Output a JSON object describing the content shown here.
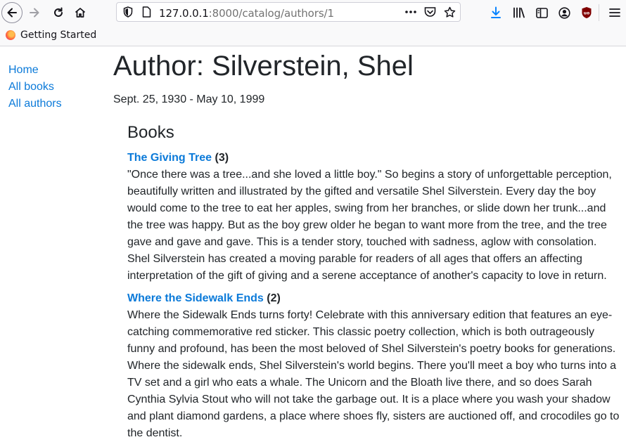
{
  "browser": {
    "url_host": "127.0.0.1",
    "url_path": ":8000/catalog/authors/1",
    "bookmark": "Getting Started"
  },
  "sidebar": {
    "items": [
      {
        "label": "Home"
      },
      {
        "label": "All books"
      },
      {
        "label": "All authors"
      }
    ]
  },
  "author": {
    "title": "Author: Silverstein, Shel",
    "dates": "Sept. 25, 1930 - May 10, 1999"
  },
  "books": {
    "heading": "Books",
    "items": [
      {
        "title": "The Giving Tree",
        "count": "(3)",
        "summary": "\"Once there was a tree...and she loved a little boy.\" So begins a story of unforgettable perception, beautifully written and illustrated by the gifted and versatile Shel Silverstein. Every day the boy would come to the tree to eat her apples, swing from her branches, or slide down her trunk...and the tree was happy. But as the boy grew older he began to want more from the tree, and the tree gave and gave and gave. This is a tender story, touched with sadness, aglow with consolation. Shel Silverstein has created a moving parable for readers of all ages that offers an affecting interpretation of the gift of giving and a serene acceptance of another's capacity to love in return."
      },
      {
        "title": "Where the Sidewalk Ends",
        "count": "(2)",
        "summary": "Where the Sidewalk Ends turns forty! Celebrate with this anniversary edition that features an eye-catching commemorative red sticker. This classic poetry collection, which is both outrageously funny and profound, has been the most beloved of Shel Silverstein's poetry books for generations. Where the sidewalk ends, Shel Silverstein's world begins. There you'll meet a boy who turns into a TV set and a girl who eats a whale. The Unicorn and the Bloath live there, and so does Sarah Cynthia Sylvia Stout who will not take the garbage out. It is a place where you wash your shadow and plant diamond gardens, a place where shoes fly, sisters are auctioned off, and crocodiles go to the dentist."
      }
    ]
  },
  "colors": {
    "link": "#0b7ad9",
    "download_icon": "#0a84ff",
    "ublock_icon": "#800000"
  },
  "icons": [
    "back-icon",
    "forward-icon",
    "reload-icon",
    "home-icon",
    "shield-icon",
    "page-icon",
    "more-icon",
    "pocket-icon",
    "star-icon",
    "download-icon",
    "library-icon",
    "sidebar-icon",
    "account-icon",
    "ublock-icon",
    "menu-icon",
    "firefox-icon"
  ]
}
